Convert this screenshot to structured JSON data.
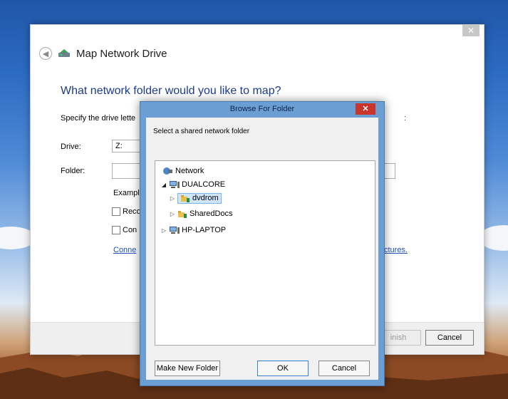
{
  "wizard": {
    "title": "Map Network Drive",
    "close_glyph": "✕",
    "question": "What network folder would you like to map?",
    "specify_text": "Specify the drive lette",
    "specify_link_tail": ":",
    "drive_label": "Drive:",
    "drive_value": "Z:",
    "folder_label": "Folder:",
    "folder_value": "",
    "example_text": "Exampl",
    "reconnect_label": "Reco",
    "credentials_label": "Con",
    "connect_link": "Conne",
    "pictures_link_tail": "ctures.",
    "finish_label": "inish",
    "cancel_label": "Cancel",
    "icons": {
      "back": "back-arrow-icon",
      "network_drive": "network-drive-icon"
    }
  },
  "browse": {
    "title": "Browse For Folder",
    "close_glyph": "✕",
    "prompt": "Select a shared network folder",
    "tree": [
      {
        "label": "Network",
        "icon": "network-icon",
        "level": 0,
        "expander": ""
      },
      {
        "label": "DUALCORE",
        "icon": "computer-icon",
        "level": 1,
        "expander": "◢"
      },
      {
        "label": "dvdrom",
        "icon": "shared-folder-icon",
        "level": 2,
        "expander": "▷",
        "selected": true
      },
      {
        "label": "SharedDocs",
        "icon": "shared-folder-icon",
        "level": 2,
        "expander": "▷"
      },
      {
        "label": "HP-LAPTOP",
        "icon": "computer-icon",
        "level": 1,
        "expander": "▷"
      }
    ],
    "make_new_folder_label": "Make New Folder",
    "ok_label": "OK",
    "cancel_label": "Cancel"
  }
}
